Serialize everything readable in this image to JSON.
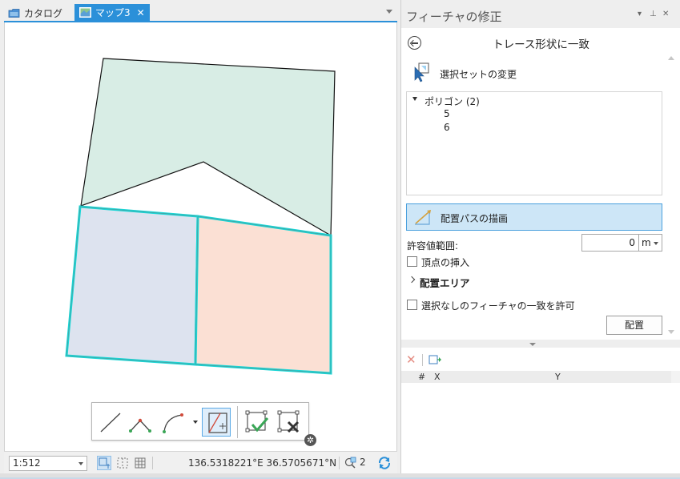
{
  "doc_tabs": [
    {
      "label": "カタログ",
      "icon": "folder-icon",
      "active": false
    },
    {
      "label": "マップ3",
      "icon": "map-icon",
      "active": true
    }
  ],
  "status": {
    "scale": "1:512",
    "coordinates": "136.5318221°E 36.5705671°N",
    "selection_count": "2"
  },
  "pane": {
    "title": "フィーチャの修正",
    "tool_title": "トレース形状に一致",
    "change_selection_label": "選択セットの変更",
    "tree": {
      "root_label": "ポリゴン (2)",
      "items": [
        "5",
        "6"
      ]
    },
    "draw_path_label": "配置パスの描画",
    "tolerance_label": "許容値範囲:",
    "tolerance_value": "0",
    "tolerance_unit": "m",
    "insert_vertices_label": "頂点の挿入",
    "placement_area_label": "配置エリア",
    "allow_unselected_label": "選択なしのフィーチャの一致を許可",
    "apply_label": "配置"
  },
  "grid": {
    "columns": [
      "#",
      "X",
      "Y"
    ]
  },
  "colors": {
    "accent": "#2b90d9",
    "selection_outline": "#1ad6d6",
    "polygon_top_fill": "#d8ede5",
    "polygon_left_fill": "#dde3ef",
    "polygon_right_fill": "#fbe0d4"
  }
}
